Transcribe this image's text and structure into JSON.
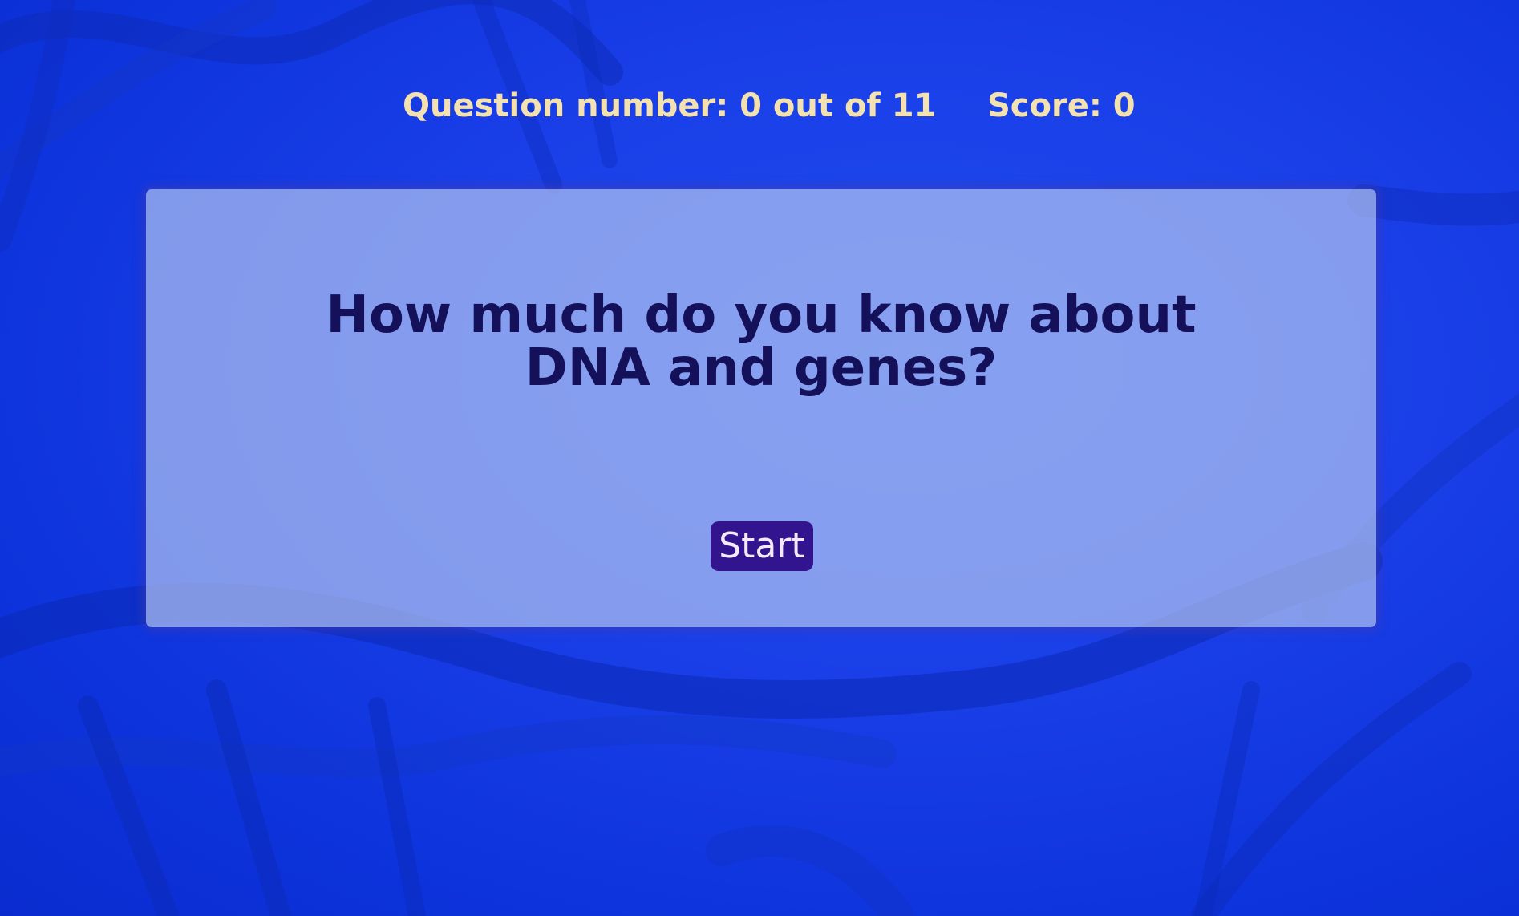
{
  "header": {
    "question_counter": "Question number: 0 out of 11",
    "score": "Score: 0"
  },
  "card": {
    "question": "How much do you know about DNA and genes?",
    "start_label": "Start"
  },
  "background": {
    "image": "dna-double-helix"
  },
  "colors": {
    "background": "#1a3fe8",
    "header_text": "#f3e1b0",
    "card": "#b8c8f0",
    "question_text": "#14105a",
    "button": "#32148e",
    "button_text": "#f4eaf6"
  }
}
